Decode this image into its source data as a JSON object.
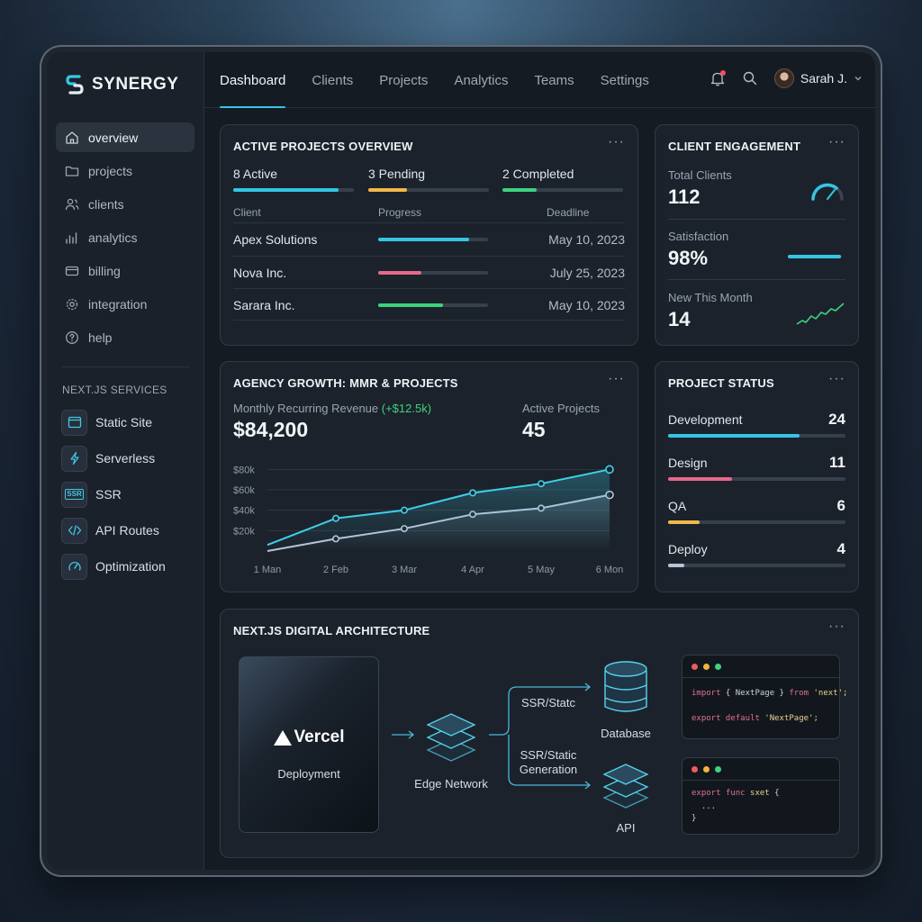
{
  "brand": {
    "name": "SYNERGY"
  },
  "sidebar": {
    "items": [
      {
        "label": "overview",
        "icon": "home-icon",
        "active": true
      },
      {
        "label": "projects",
        "icon": "folder-icon"
      },
      {
        "label": "clients",
        "icon": "users-icon"
      },
      {
        "label": "analytics",
        "icon": "bar-chart-icon"
      },
      {
        "label": "billing",
        "icon": "credit-card-icon"
      },
      {
        "label": "integration",
        "icon": "gear-icon"
      },
      {
        "label": "help",
        "icon": "help-circle-icon"
      }
    ],
    "services_title": "NEXT.JS SERVICES",
    "services": [
      {
        "label": "Static Site",
        "icon": "browser-window-icon"
      },
      {
        "label": "Serverless",
        "icon": "lightning-icon"
      },
      {
        "label": "SSR",
        "icon": "ssr-icon",
        "icon_text": "SSR"
      },
      {
        "label": "API Routes",
        "icon": "code-brackets-icon"
      },
      {
        "label": "Optimization",
        "icon": "speedometer-icon"
      }
    ]
  },
  "topnav": {
    "tabs": [
      "Dashboard",
      "Clients",
      "Projects",
      "Analytics",
      "Teams",
      "Settings"
    ],
    "active_tab": "Dashboard",
    "user_name": "Sarah J."
  },
  "active_projects": {
    "title": "ACTIVE PROJECTS OVERVIEW",
    "more": "···",
    "stats": [
      {
        "label": "8 Active",
        "color": "#34c6e3",
        "progress": 0.87
      },
      {
        "label": "3 Pending",
        "color": "#f2b84b",
        "progress": 0.32
      },
      {
        "label": "2 Completed",
        "color": "#3ed27f",
        "progress": 0.28
      }
    ],
    "columns": [
      "Client",
      "Progress",
      "Deadline"
    ],
    "rows": [
      {
        "client": "Apex Solutions",
        "progress": 0.83,
        "color": "#34c6e3",
        "deadline": "May 10, 2023"
      },
      {
        "client": "Nova Inc.",
        "progress": 0.39,
        "color": "#e9688a",
        "deadline": "July 25, 2023"
      },
      {
        "client": "Sarara Inc.",
        "progress": 0.59,
        "color": "#3ed27f",
        "deadline": "May 10, 2023"
      }
    ]
  },
  "engagement": {
    "title": "CLIENT ENGAGEMENT",
    "more": "···",
    "total_label": "Total Clients",
    "total_value": "112",
    "satisfaction_label": "Satisfaction",
    "satisfaction_value": "98%",
    "satisfaction_progress": 0.98,
    "new_label": "New This Month",
    "new_value": "14"
  },
  "growth": {
    "title": "AGENCY GROWTH: MMR & PROJECTS",
    "more": "···",
    "mrr_label": "Monthly Recurring Revenue",
    "mrr_delta": "(+$12.5k)",
    "mrr_value": "$84,200",
    "projects_label": "Active Projects",
    "projects_value": "45"
  },
  "chart_data": {
    "type": "line",
    "x": [
      "1 Man",
      "2 Feb",
      "3 Mar",
      "4 Apr",
      "5 May",
      "6 Mon"
    ],
    "yticks": [
      "$80k",
      "$60k",
      "$40k",
      "$20k"
    ],
    "ylim": [
      0,
      90
    ],
    "grid": true,
    "series": [
      {
        "values": [
          6,
          32,
          40,
          57,
          66,
          80
        ],
        "color": "#3fd0ea"
      },
      {
        "values": [
          0,
          12,
          22,
          36,
          42,
          55
        ],
        "color": "#b9c3d8"
      }
    ]
  },
  "status": {
    "title": "PROJECT STATUS",
    "more": "···",
    "rows": [
      {
        "name": "Development",
        "count": "24",
        "color": "#34c6e3",
        "progress": 0.74
      },
      {
        "name": "Design",
        "count": "11",
        "color": "#e9688a",
        "progress": 0.36
      },
      {
        "name": "QA",
        "count": "6",
        "color": "#f2b84b",
        "progress": 0.18
      },
      {
        "name": "Deploy",
        "count": "4",
        "color": "#b7c3d6",
        "progress": 0.09
      }
    ]
  },
  "architecture": {
    "title": "NEXT.JS DIGITAL ARCHITECTURE",
    "more": "···",
    "vercel_name": "Vercel",
    "vercel_caption": "Deployment",
    "edge_label": "Edge Network",
    "ssr_label_1": "SSR/Statc",
    "ssr_label_2_line1": "SSR/Static",
    "ssr_label_2_line2": "Generation",
    "database_label": "Database",
    "api_label": "API",
    "code1": {
      "line1_kw": "import",
      "line1_mid": " { NextPage } ",
      "line1_kw2": "from",
      "line1_str": " 'next';",
      "line2_kw": "export default",
      "line2_str": " 'NextPage';"
    },
    "code2": {
      "line1_kw": "export func",
      "line1_str": " sxet",
      "line1_end": " {",
      "line2": "  ...",
      "line3": "}"
    }
  }
}
